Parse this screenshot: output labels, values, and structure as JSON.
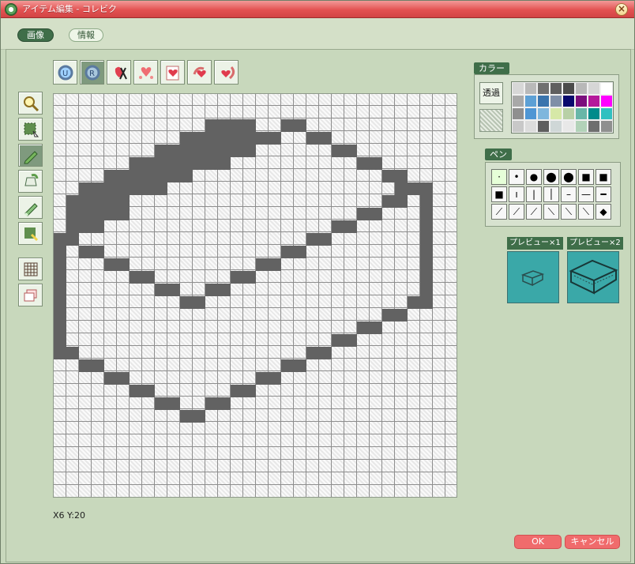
{
  "window": {
    "title": "アイテム編集 - コレビク"
  },
  "tabs": [
    {
      "label": "画像",
      "active": true
    },
    {
      "label": "情報",
      "active": false
    }
  ],
  "top_tools": [
    {
      "name": "undo-icon"
    },
    {
      "name": "redo-icon"
    },
    {
      "name": "cut-icon"
    },
    {
      "name": "sparkle-heart-icon"
    },
    {
      "name": "flip-heart-icon"
    },
    {
      "name": "rotate-heart-icon"
    },
    {
      "name": "turn-heart-icon"
    }
  ],
  "left_tools": [
    {
      "name": "zoom-icon"
    },
    {
      "name": "select-icon"
    },
    {
      "name": "pencil-icon"
    },
    {
      "name": "fill-icon"
    },
    {
      "name": "eraser-icon"
    },
    {
      "name": "picker-icon"
    },
    {
      "name": "grid-icon"
    },
    {
      "name": "layers-icon"
    }
  ],
  "status": {
    "coords": "X6 Y:20"
  },
  "color_panel": {
    "label": "カラー",
    "transparent_label": "透過",
    "palette": [
      "#d7d7d7",
      "#b9b9b9",
      "#707070",
      "#5f5f5f",
      "#4b4b4b",
      "#b8b8b8",
      "#d6d6d6",
      "#ffffff",
      "#a8a8a8",
      "#5da0d5",
      "#3a74ad",
      "#7f8fa7",
      "#09096d",
      "#7b0e7d",
      "#b5199b",
      "#ff00ff",
      "#8f8f8f",
      "#4f96d4",
      "#7fb6dd",
      "#d6e8a7",
      "#b8d0a6",
      "#68b6a8",
      "#008b8b",
      "#30c0c0",
      "#c8c8c8",
      "#dcdcdc",
      "#5e5e5e",
      "#cfd7d7",
      "#e8e8e8",
      "#b2d2b8",
      "#6e6e6e",
      "#8f8f8f"
    ]
  },
  "pen_panel": {
    "label": "ペン",
    "pens": [
      "·",
      "•",
      "●",
      "⬤",
      "⬤",
      "■",
      "■",
      "■",
      "ı",
      "|",
      "│",
      "–",
      "—",
      "━",
      "⟋",
      "⟋",
      "⟋",
      "⟍",
      "⟍",
      "⟍",
      "◆"
    ]
  },
  "preview": {
    "x1_label": "プレビュー×1",
    "x2_label": "プレビュー×2"
  },
  "buttons": {
    "ok": "OK",
    "cancel": "キャンセル"
  }
}
